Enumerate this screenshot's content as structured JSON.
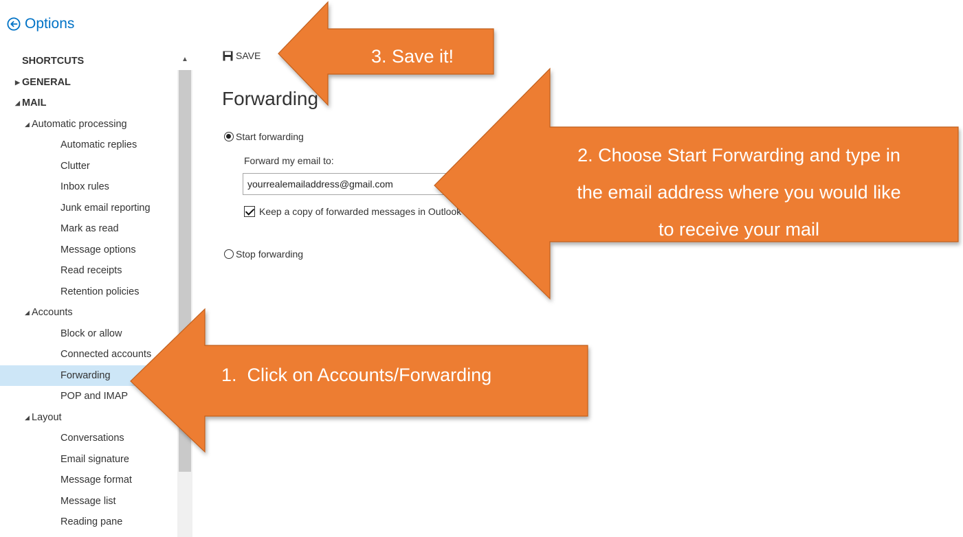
{
  "header": {
    "title": "Options",
    "back_icon": "back-arrow-circle-icon"
  },
  "sidebar": {
    "items": [
      {
        "label": "SHORTCUTS",
        "level": 0,
        "expander": ""
      },
      {
        "label": "GENERAL",
        "level": 0,
        "expander": "collapsed"
      },
      {
        "label": "MAIL",
        "level": 0,
        "expander": "expanded"
      },
      {
        "label": "Automatic processing",
        "level": 1,
        "expander": "expanded"
      },
      {
        "label": "Automatic replies",
        "level": 2
      },
      {
        "label": "Clutter",
        "level": 2
      },
      {
        "label": "Inbox rules",
        "level": 2
      },
      {
        "label": "Junk email reporting",
        "level": 2
      },
      {
        "label": "Mark as read",
        "level": 2
      },
      {
        "label": "Message options",
        "level": 2
      },
      {
        "label": "Read receipts",
        "level": 2
      },
      {
        "label": "Retention policies",
        "level": 2
      },
      {
        "label": "Accounts",
        "level": 1,
        "expander": "expanded"
      },
      {
        "label": "Block or allow",
        "level": 2
      },
      {
        "label": "Connected accounts",
        "level": 2
      },
      {
        "label": "Forwarding",
        "level": 2,
        "selected": true
      },
      {
        "label": "POP and IMAP",
        "level": 2
      },
      {
        "label": "Layout",
        "level": 1,
        "expander": "expanded"
      },
      {
        "label": "Conversations",
        "level": 2
      },
      {
        "label": "Email signature",
        "level": 2
      },
      {
        "label": "Message format",
        "level": 2
      },
      {
        "label": "Message list",
        "level": 2
      },
      {
        "label": "Reading pane",
        "level": 2
      }
    ],
    "selected_color": "#cde6f7"
  },
  "toolbar": {
    "save_label": "SAVE",
    "save_icon": "floppy-disk-icon"
  },
  "main": {
    "heading": "Forwarding",
    "start_label": "Start forwarding",
    "start_selected": true,
    "forward_label": "Forward my email to:",
    "email_value": "yourrealemailaddress@gmail.com",
    "keep_copy_label": "Keep a copy of forwarded messages in Outlook Web App",
    "keep_copy_checked": true,
    "stop_label": "Stop forwarding"
  },
  "annotations": {
    "step1": "1.  Click on Accounts/Forwarding",
    "step2_lines": [
      "2. Choose Start Forwarding and type in",
      "the email address where you would like",
      "to receive your mail"
    ],
    "step3": "3. Save it!",
    "color": "#ed7d31"
  },
  "colors": {
    "accent": "#0072c6"
  }
}
